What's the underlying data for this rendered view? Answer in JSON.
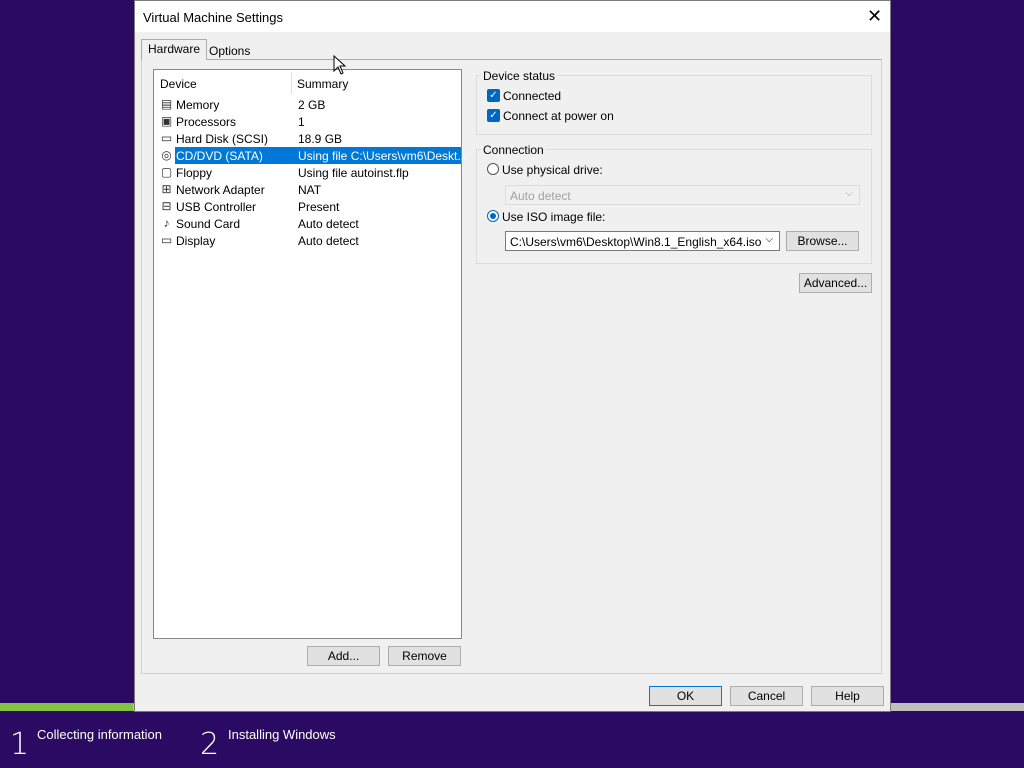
{
  "setup": {
    "progress": 0.13,
    "steps": [
      {
        "number": "1",
        "label": "Collecting information"
      },
      {
        "number": "2",
        "label": "Installing Windows"
      }
    ],
    "colors": {
      "background": "#2a0a63",
      "progress": "#84c341"
    }
  },
  "dialog": {
    "title": "Virtual Machine Settings",
    "tabs": {
      "hardware": "Hardware",
      "options": "Options"
    },
    "device_list": {
      "columns": {
        "device": "Device",
        "summary": "Summary"
      },
      "rows": [
        {
          "icon": "memory-icon",
          "device": "Memory",
          "summary": "2 GB"
        },
        {
          "icon": "processor-icon",
          "device": "Processors",
          "summary": "1"
        },
        {
          "icon": "hard-disk-icon",
          "device": "Hard Disk (SCSI)",
          "summary": "18.9 GB"
        },
        {
          "icon": "cd-dvd-icon",
          "device": "CD/DVD (SATA)",
          "summary": "Using file C:\\Users\\vm6\\Deskt...",
          "selected": true
        },
        {
          "icon": "floppy-icon",
          "device": "Floppy",
          "summary": "Using file autoinst.flp"
        },
        {
          "icon": "network-adapter-icon",
          "device": "Network Adapter",
          "summary": "NAT"
        },
        {
          "icon": "usb-controller-icon",
          "device": "USB Controller",
          "summary": "Present"
        },
        {
          "icon": "sound-card-icon",
          "device": "Sound Card",
          "summary": "Auto detect"
        },
        {
          "icon": "display-icon",
          "device": "Display",
          "summary": "Auto detect"
        }
      ]
    },
    "buttons": {
      "add": "Add...",
      "remove": "Remove",
      "ok": "OK",
      "cancel": "Cancel",
      "help": "Help",
      "browse": "Browse...",
      "advanced": "Advanced..."
    },
    "device_status": {
      "title": "Device status",
      "connected": "Connected",
      "connect_at_power_on": "Connect at power on"
    },
    "connection": {
      "title": "Connection",
      "use_physical_drive": "Use physical drive:",
      "physical_drive_value": "Auto detect",
      "use_iso": "Use ISO image file:",
      "iso_path": "C:\\Users\\vm6\\Desktop\\Win8.1_English_x64.iso"
    },
    "colors": {
      "selection": "#0078d7",
      "checkbox": "#0067c0"
    }
  }
}
